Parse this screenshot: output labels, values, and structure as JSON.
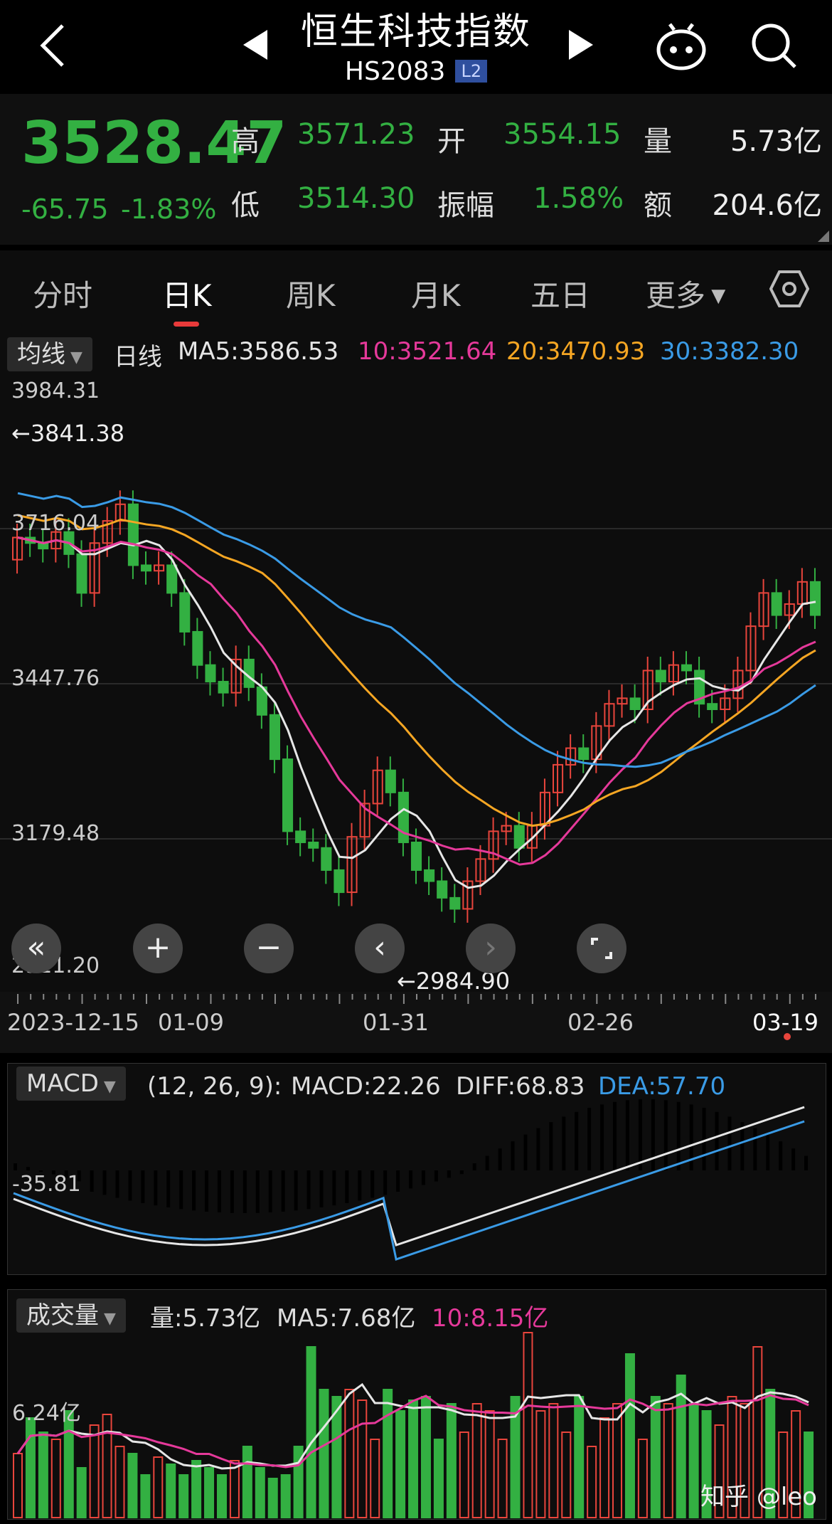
{
  "header": {
    "title": "恒生科技指数",
    "code": "HS2083",
    "badge": "L2"
  },
  "quote": {
    "price": "3528.47",
    "change": "-65.75",
    "change_pct": "-1.83%",
    "high_label": "高",
    "high": "3571.23",
    "open_label": "开",
    "open": "3554.15",
    "volume_label": "量",
    "volume": "5.73亿",
    "low_label": "低",
    "low": "3514.30",
    "amplitude_label": "振幅",
    "amplitude": "1.58%",
    "amount_label": "额",
    "amount": "204.6亿"
  },
  "tabs": [
    "分时",
    "日K",
    "周K",
    "月K",
    "五日",
    "更多"
  ],
  "active_tab": 1,
  "kline": {
    "indicator_dropdown": "均线",
    "period": "日线",
    "ma5": "MA5:3586.53",
    "ma10": "10:3521.64",
    "ma20": "20:3470.93",
    "ma30": "30:3382.30",
    "y_labels": [
      "3984.31",
      "3716.04",
      "3447.76",
      "3179.48",
      "2911.20"
    ],
    "high_marker": "←3841.38",
    "low_marker": "←2984.90",
    "x_labels": [
      "2023-12-15",
      "01-09",
      "01-31",
      "02-26",
      "03-19"
    ]
  },
  "macd": {
    "dropdown": "MACD",
    "params": "(12, 26, 9):",
    "macd": "MACD:22.26",
    "diff": "DIFF:68.83",
    "dea": "DEA:57.70",
    "axis_label": "-35.81"
  },
  "volume": {
    "dropdown": "成交量",
    "vol": "量:5.73亿",
    "ma5": "MA5:7.68亿",
    "ma10": "10:8.15亿",
    "axis_label": "6.24亿"
  },
  "watermark": "知乎 @leo",
  "colors": {
    "up": "#e8453c",
    "down": "#33b042",
    "ma5": "#e6e6e6",
    "ma10": "#e5399a",
    "ma20": "#f5a623",
    "ma30": "#3a9be6",
    "bg": "#0d0d0d"
  }
}
